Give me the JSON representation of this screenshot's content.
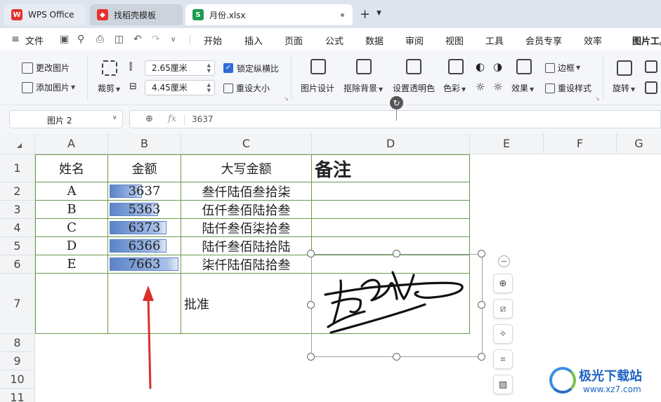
{
  "tabs": [
    {
      "label": "WPS Office",
      "icon": "wps-icon"
    },
    {
      "label": "找稻壳模板",
      "icon": "docer-icon"
    },
    {
      "label": "月份.xlsx",
      "icon": "sheet-icon",
      "icon_text": "S"
    }
  ],
  "menu": {
    "file": "文件",
    "tabs": [
      "开始",
      "插入",
      "页面",
      "公式",
      "数据",
      "审阅",
      "视图",
      "工具",
      "会员专享",
      "效率",
      "图片工具"
    ],
    "active": "图片工具"
  },
  "ribbon": {
    "change_picture": "更改图片",
    "add_picture": "添加图片",
    "crop": "裁剪",
    "height": "2.65厘米",
    "width": "4.45厘米",
    "lock_ratio": "锁定纵横比",
    "reset_size": "重设大小",
    "picture_design": "图片设计",
    "remove_bg": "抠除背景",
    "set_transparent": "设置透明色",
    "color": "色彩",
    "effects": "效果",
    "border": "边框",
    "reset_style": "重设样式",
    "rotate": "旋转"
  },
  "formula_bar": {
    "name_box": "图片 2",
    "fx": "fx",
    "value": "3637"
  },
  "columns": [
    "A",
    "B",
    "C",
    "D",
    "E",
    "F",
    "G"
  ],
  "rows": [
    "1",
    "2",
    "3",
    "4",
    "5",
    "6",
    "7",
    "8",
    "9",
    "10",
    "11"
  ],
  "table": {
    "headers": [
      "姓名",
      "金额",
      "大写金额",
      "备注"
    ],
    "data": [
      {
        "name": "A",
        "amount": "3637",
        "amount_fraction": 0.47,
        "capital": "叁仟陆佰叁拾柒"
      },
      {
        "name": "B",
        "amount": "5363",
        "amount_fraction": 0.7,
        "capital": "伍仟叁佰陆拾叁"
      },
      {
        "name": "C",
        "amount": "6373",
        "amount_fraction": 0.83,
        "capital": "陆仟叁佰柒拾叁"
      },
      {
        "name": "D",
        "amount": "6366",
        "amount_fraction": 0.83,
        "capital": "陆仟叁佰陆拾陆"
      },
      {
        "name": "E",
        "amount": "7663",
        "amount_fraction": 1.0,
        "capital": "柒仟陆佰陆拾叁"
      }
    ],
    "approve": "批准"
  },
  "watermark": {
    "title": "极光下载站",
    "url": "www.xz7.com"
  },
  "colors": {
    "accent": "#1d4fd8",
    "databar": "#5a83c8",
    "border_green": "#6a9a50",
    "arrow": "#d9302c"
  }
}
